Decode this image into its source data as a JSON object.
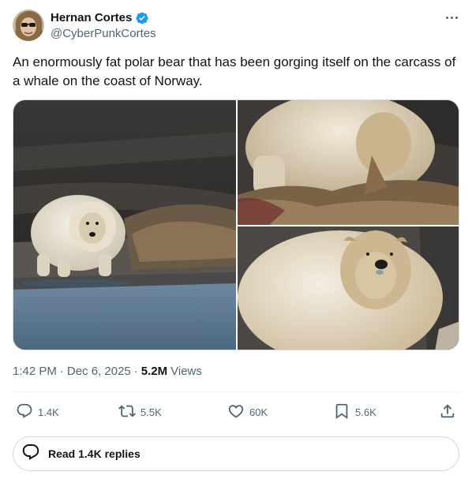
{
  "author": {
    "display_name": "Hernan Cortes",
    "handle": "@CyberPunkCortes",
    "verified": true
  },
  "tweet": {
    "text": "An enormously fat polar bear that has been gorging itself on the carcass of a whale on the coast of Norway."
  },
  "media": {
    "count": 3
  },
  "meta": {
    "time": "1:42 PM",
    "separator": "·",
    "date": "Dec 6, 2025",
    "views_count": "5.2M",
    "views_label": "Views"
  },
  "actions": {
    "replies": "1.4K",
    "reposts": "5.5K",
    "likes": "60K",
    "bookmarks": "5.6K"
  },
  "read_replies_label": "Read 1.4K replies",
  "colors": {
    "accent": "#1d9bf0",
    "secondary_text": "#536471",
    "primary_text": "#0f1419",
    "border": "#cfd9de"
  }
}
